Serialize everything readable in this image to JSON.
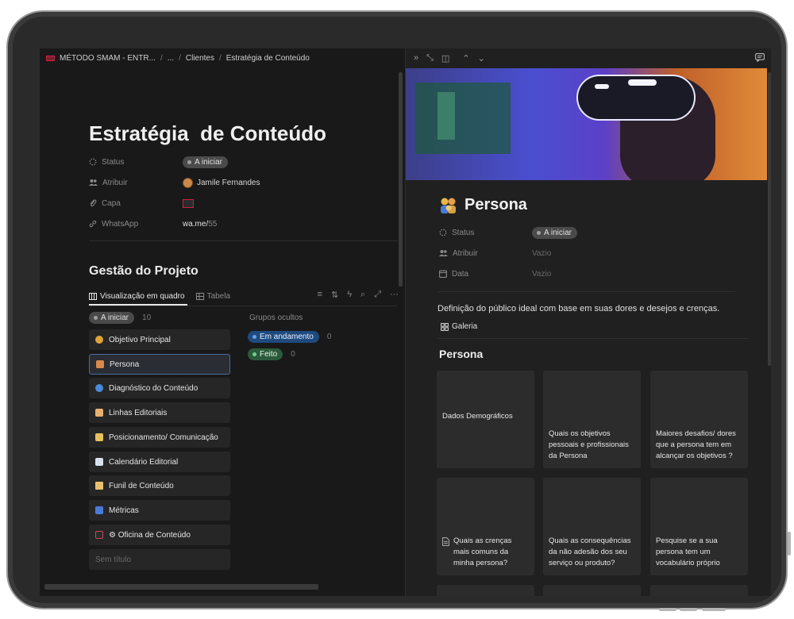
{
  "breadcrumb": {
    "workspace": "MÉTODO SMAM - ENTR...",
    "ellipsis": "...",
    "parent": "Clientes",
    "current": "Estratégia de Conteúdo"
  },
  "page": {
    "title": "Estratégia  de Conteúdo",
    "properties": [
      {
        "label": "Status",
        "value": "A iniciar",
        "icon": "status-icon"
      },
      {
        "label": "Atribuir",
        "value": "Jamile Fernandes",
        "icon": "people-icon"
      },
      {
        "label": "Capa",
        "value": "",
        "icon": "paperclip-icon"
      },
      {
        "label": "WhatsApp",
        "value": "wa.me/",
        "value_suffix": "55",
        "icon": "link-icon"
      }
    ]
  },
  "project": {
    "title": "Gestão do Projeto",
    "views": [
      {
        "label": "Visualização em quadro",
        "active": true
      },
      {
        "label": "Tabela",
        "active": false
      }
    ],
    "toolbar": [
      "filter-icon",
      "sort-icon",
      "lightning-icon",
      "search-icon",
      "expand-icon",
      "more-icon"
    ],
    "group": {
      "label": "A iniciar",
      "count": "10"
    },
    "cards": [
      {
        "label": "Objetivo Principal",
        "color": "#e0a23a"
      },
      {
        "label": "Persona",
        "color": "#d88a4a",
        "selected": true
      },
      {
        "label": "Diagnóstico do Conteúdo",
        "color": "#4a8ad8"
      },
      {
        "label": "Linhas Editoriais",
        "color": "#e8b070"
      },
      {
        "label": "Posicionamento/ Comunicação",
        "color": "#e8c060"
      },
      {
        "label": "Calendário Editorial",
        "color": "#d8e0ea"
      },
      {
        "label": "Funil de Conteúdo",
        "color": "#e8c070"
      },
      {
        "label": "Métricas",
        "color": "#4a7ad8"
      },
      {
        "label": "⚙ Oficina de Conteúdo",
        "color": "#c24a5a"
      },
      {
        "label": "Sem título",
        "color": ""
      }
    ],
    "hidden_groups": {
      "label": "Grupos ocultos",
      "items": [
        {
          "label": "Em andamento",
          "count": "0"
        },
        {
          "label": "Feito",
          "count": "0"
        }
      ]
    }
  },
  "right": {
    "title": "Persona",
    "properties": [
      {
        "label": "Status",
        "value": "A iniciar"
      },
      {
        "label": "Atribuir",
        "value": "Vazio"
      },
      {
        "label": "Data",
        "value": "Vazio"
      }
    ],
    "description": "Definição do público ideal com base em suas dores e desejos e crenças.",
    "gallery_tab": "Galeria",
    "section_title": "Persona",
    "gallery": [
      "Dados Demográficos",
      "Quais os objetivos pessoais e profissionais da Persona",
      "Maiores desafios/ dores que a persona tem em alcançar os objetivos ?",
      "Quais as crenças mais comuns da minha persona?",
      "Quais as consequências da não adesão dos seu serviço ou produto?",
      "Pesquise se a sua persona tem um vocabulário próprio"
    ]
  }
}
